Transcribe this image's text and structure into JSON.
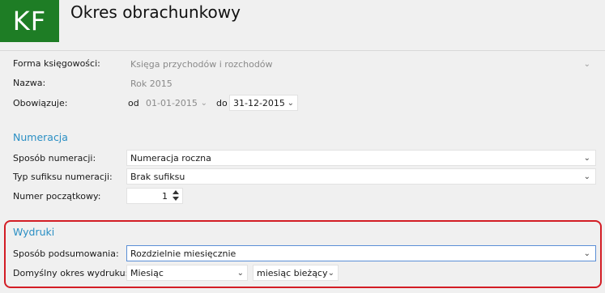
{
  "header": {
    "logo_text": "KF",
    "title": "Okres obrachunkowy"
  },
  "general": {
    "forma_label": "Forma księgowości:",
    "forma_value": "Księga przychodów i rozchodów",
    "nazwa_label": "Nazwa:",
    "nazwa_value": "Rok 2015",
    "obowiazuje_label": "Obowiązuje:",
    "od_label": "od",
    "od_value": "01-01-2015",
    "do_label": "do",
    "do_value": "31-12-2015"
  },
  "numeracja": {
    "title": "Numeracja",
    "sposob_label": "Sposób numeracji:",
    "sposob_value": "Numeracja roczna",
    "typ_label": "Typ sufiksu numeracji:",
    "typ_value": "Brak sufiksu",
    "numer_label": "Numer początkowy:",
    "numer_value": "1"
  },
  "wydruki": {
    "title": "Wydruki",
    "podsumowanie_label": "Sposób podsumowania:",
    "podsumowanie_value": "Rozdzielnie miesięcznie",
    "okres_label": "Domyślny okres wydruku:",
    "okres_value": "Miesiąc",
    "okres_extra_value": "miesiąc bieżący"
  },
  "colors": {
    "logo_bg": "#1e7d25",
    "section_title": "#2a8fc4",
    "highlight_border": "#d31d25",
    "focus_border": "#5b8fd6"
  },
  "icons": {
    "dropdown": "chevron-down-icon",
    "spinner": "spinner-icon"
  }
}
